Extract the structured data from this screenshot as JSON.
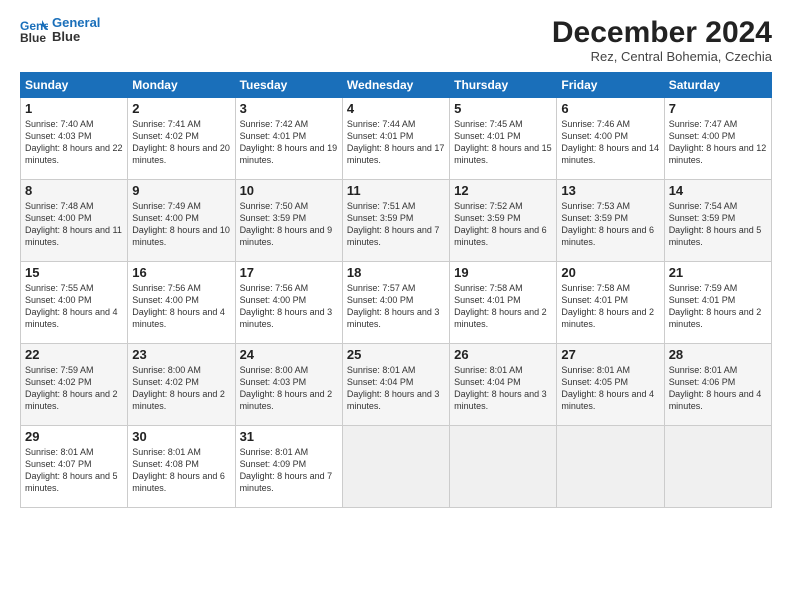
{
  "logo": {
    "line1": "General",
    "line2": "Blue"
  },
  "title": "December 2024",
  "subtitle": "Rez, Central Bohemia, Czechia",
  "days_header": [
    "Sunday",
    "Monday",
    "Tuesday",
    "Wednesday",
    "Thursday",
    "Friday",
    "Saturday"
  ],
  "weeks": [
    [
      {
        "day": "1",
        "sunrise": "Sunrise: 7:40 AM",
        "sunset": "Sunset: 4:03 PM",
        "daylight": "Daylight: 8 hours and 22 minutes."
      },
      {
        "day": "2",
        "sunrise": "Sunrise: 7:41 AM",
        "sunset": "Sunset: 4:02 PM",
        "daylight": "Daylight: 8 hours and 20 minutes."
      },
      {
        "day": "3",
        "sunrise": "Sunrise: 7:42 AM",
        "sunset": "Sunset: 4:01 PM",
        "daylight": "Daylight: 8 hours and 19 minutes."
      },
      {
        "day": "4",
        "sunrise": "Sunrise: 7:44 AM",
        "sunset": "Sunset: 4:01 PM",
        "daylight": "Daylight: 8 hours and 17 minutes."
      },
      {
        "day": "5",
        "sunrise": "Sunrise: 7:45 AM",
        "sunset": "Sunset: 4:01 PM",
        "daylight": "Daylight: 8 hours and 15 minutes."
      },
      {
        "day": "6",
        "sunrise": "Sunrise: 7:46 AM",
        "sunset": "Sunset: 4:00 PM",
        "daylight": "Daylight: 8 hours and 14 minutes."
      },
      {
        "day": "7",
        "sunrise": "Sunrise: 7:47 AM",
        "sunset": "Sunset: 4:00 PM",
        "daylight": "Daylight: 8 hours and 12 minutes."
      }
    ],
    [
      {
        "day": "8",
        "sunrise": "Sunrise: 7:48 AM",
        "sunset": "Sunset: 4:00 PM",
        "daylight": "Daylight: 8 hours and 11 minutes."
      },
      {
        "day": "9",
        "sunrise": "Sunrise: 7:49 AM",
        "sunset": "Sunset: 4:00 PM",
        "daylight": "Daylight: 8 hours and 10 minutes."
      },
      {
        "day": "10",
        "sunrise": "Sunrise: 7:50 AM",
        "sunset": "Sunset: 3:59 PM",
        "daylight": "Daylight: 8 hours and 9 minutes."
      },
      {
        "day": "11",
        "sunrise": "Sunrise: 7:51 AM",
        "sunset": "Sunset: 3:59 PM",
        "daylight": "Daylight: 8 hours and 7 minutes."
      },
      {
        "day": "12",
        "sunrise": "Sunrise: 7:52 AM",
        "sunset": "Sunset: 3:59 PM",
        "daylight": "Daylight: 8 hours and 6 minutes."
      },
      {
        "day": "13",
        "sunrise": "Sunrise: 7:53 AM",
        "sunset": "Sunset: 3:59 PM",
        "daylight": "Daylight: 8 hours and 6 minutes."
      },
      {
        "day": "14",
        "sunrise": "Sunrise: 7:54 AM",
        "sunset": "Sunset: 3:59 PM",
        "daylight": "Daylight: 8 hours and 5 minutes."
      }
    ],
    [
      {
        "day": "15",
        "sunrise": "Sunrise: 7:55 AM",
        "sunset": "Sunset: 4:00 PM",
        "daylight": "Daylight: 8 hours and 4 minutes."
      },
      {
        "day": "16",
        "sunrise": "Sunrise: 7:56 AM",
        "sunset": "Sunset: 4:00 PM",
        "daylight": "Daylight: 8 hours and 4 minutes."
      },
      {
        "day": "17",
        "sunrise": "Sunrise: 7:56 AM",
        "sunset": "Sunset: 4:00 PM",
        "daylight": "Daylight: 8 hours and 3 minutes."
      },
      {
        "day": "18",
        "sunrise": "Sunrise: 7:57 AM",
        "sunset": "Sunset: 4:00 PM",
        "daylight": "Daylight: 8 hours and 3 minutes."
      },
      {
        "day": "19",
        "sunrise": "Sunrise: 7:58 AM",
        "sunset": "Sunset: 4:01 PM",
        "daylight": "Daylight: 8 hours and 2 minutes."
      },
      {
        "day": "20",
        "sunrise": "Sunrise: 7:58 AM",
        "sunset": "Sunset: 4:01 PM",
        "daylight": "Daylight: 8 hours and 2 minutes."
      },
      {
        "day": "21",
        "sunrise": "Sunrise: 7:59 AM",
        "sunset": "Sunset: 4:01 PM",
        "daylight": "Daylight: 8 hours and 2 minutes."
      }
    ],
    [
      {
        "day": "22",
        "sunrise": "Sunrise: 7:59 AM",
        "sunset": "Sunset: 4:02 PM",
        "daylight": "Daylight: 8 hours and 2 minutes."
      },
      {
        "day": "23",
        "sunrise": "Sunrise: 8:00 AM",
        "sunset": "Sunset: 4:02 PM",
        "daylight": "Daylight: 8 hours and 2 minutes."
      },
      {
        "day": "24",
        "sunrise": "Sunrise: 8:00 AM",
        "sunset": "Sunset: 4:03 PM",
        "daylight": "Daylight: 8 hours and 2 minutes."
      },
      {
        "day": "25",
        "sunrise": "Sunrise: 8:01 AM",
        "sunset": "Sunset: 4:04 PM",
        "daylight": "Daylight: 8 hours and 3 minutes."
      },
      {
        "day": "26",
        "sunrise": "Sunrise: 8:01 AM",
        "sunset": "Sunset: 4:04 PM",
        "daylight": "Daylight: 8 hours and 3 minutes."
      },
      {
        "day": "27",
        "sunrise": "Sunrise: 8:01 AM",
        "sunset": "Sunset: 4:05 PM",
        "daylight": "Daylight: 8 hours and 4 minutes."
      },
      {
        "day": "28",
        "sunrise": "Sunrise: 8:01 AM",
        "sunset": "Sunset: 4:06 PM",
        "daylight": "Daylight: 8 hours and 4 minutes."
      }
    ],
    [
      {
        "day": "29",
        "sunrise": "Sunrise: 8:01 AM",
        "sunset": "Sunset: 4:07 PM",
        "daylight": "Daylight: 8 hours and 5 minutes."
      },
      {
        "day": "30",
        "sunrise": "Sunrise: 8:01 AM",
        "sunset": "Sunset: 4:08 PM",
        "daylight": "Daylight: 8 hours and 6 minutes."
      },
      {
        "day": "31",
        "sunrise": "Sunrise: 8:01 AM",
        "sunset": "Sunset: 4:09 PM",
        "daylight": "Daylight: 8 hours and 7 minutes."
      },
      null,
      null,
      null,
      null
    ]
  ]
}
